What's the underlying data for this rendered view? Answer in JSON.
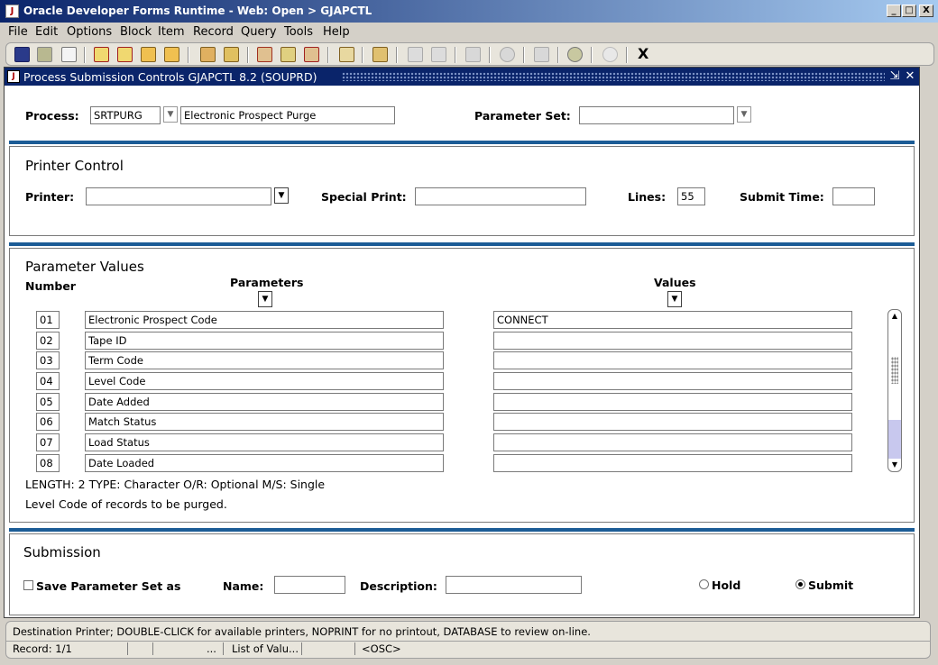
{
  "window": {
    "title": "Oracle Developer Forms Runtime - Web:  Open > GJAPCTL",
    "minimize": "_",
    "maximize": "□",
    "close": "X"
  },
  "menu": [
    "File",
    "Edit",
    "Options",
    "Block",
    "Item",
    "Record",
    "Query",
    "Tools",
    "Help"
  ],
  "toolbar": {
    "exit_label": "X"
  },
  "form": {
    "title": "Process Submission Controls  GJAPCTL  8.2  (SOUPRD)",
    "header": {
      "process_label": "Process:",
      "process_code": "SRTPURG",
      "process_desc": "Electronic Prospect Purge",
      "parameter_set_label": "Parameter Set:",
      "parameter_set_value": ""
    },
    "printer_control": {
      "title": "Printer Control",
      "printer_label": "Printer:",
      "printer_value": "",
      "special_print_label": "Special Print:",
      "special_print_value": "",
      "lines_label": "Lines:",
      "lines_value": "55",
      "submit_time_label": "Submit Time:",
      "submit_time_value": ""
    },
    "parameter_values": {
      "title": "Parameter Values",
      "number_header": "Number",
      "parameters_header": "Parameters",
      "values_header": "Values",
      "rows": [
        {
          "number": "01",
          "parameter": "Electronic Prospect Code",
          "value": "CONNECT"
        },
        {
          "number": "02",
          "parameter": "Tape ID",
          "value": ""
        },
        {
          "number": "03",
          "parameter": "Term Code",
          "value": ""
        },
        {
          "number": "04",
          "parameter": "Level Code",
          "value": ""
        },
        {
          "number": "05",
          "parameter": "Date Added",
          "value": ""
        },
        {
          "number": "06",
          "parameter": "Match Status",
          "value": ""
        },
        {
          "number": "07",
          "parameter": "Load Status",
          "value": ""
        },
        {
          "number": "08",
          "parameter": "Date Loaded",
          "value": ""
        }
      ],
      "info_line": "LENGTH: 2 TYPE: Character O/R: Optional M/S: Single",
      "help_line": "Level Code of records to be purged."
    },
    "submission": {
      "title": "Submission",
      "save_label": "Save Parameter Set as",
      "name_label": "Name:",
      "name_value": "",
      "description_label": "Description:",
      "description_value": "",
      "hold_label": "Hold",
      "submit_label": "Submit"
    }
  },
  "status": {
    "message": "Destination Printer; DOUBLE-CLICK for available printers, NOPRINT for no printout, DATABASE to review on-line.",
    "record": "Record: 1/1",
    "ellipsis": "...",
    "list_of_values": "List of Valu...",
    "osc": "<OSC>"
  }
}
